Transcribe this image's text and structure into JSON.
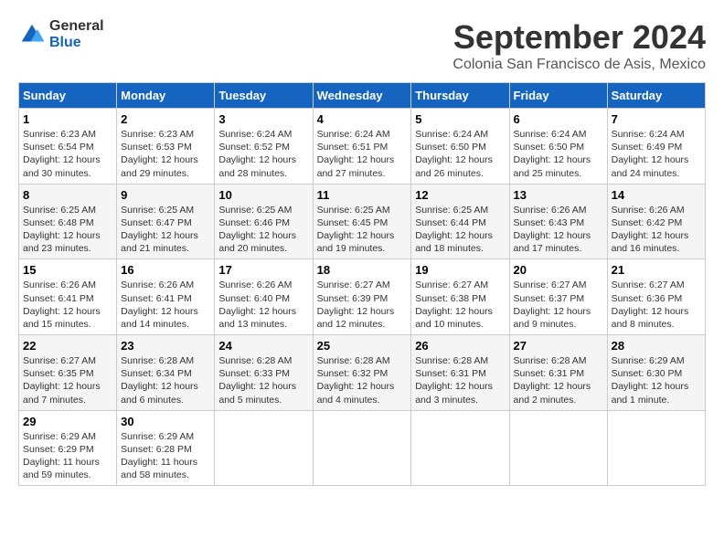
{
  "logo": {
    "general": "General",
    "blue": "Blue"
  },
  "title": "September 2024",
  "subtitle": "Colonia San Francisco de Asis, Mexico",
  "days_of_week": [
    "Sunday",
    "Monday",
    "Tuesday",
    "Wednesday",
    "Thursday",
    "Friday",
    "Saturday"
  ],
  "weeks": [
    [
      {
        "day": "1",
        "sunrise": "Sunrise: 6:23 AM",
        "sunset": "Sunset: 6:54 PM",
        "daylight": "Daylight: 12 hours and 30 minutes."
      },
      {
        "day": "2",
        "sunrise": "Sunrise: 6:23 AM",
        "sunset": "Sunset: 6:53 PM",
        "daylight": "Daylight: 12 hours and 29 minutes."
      },
      {
        "day": "3",
        "sunrise": "Sunrise: 6:24 AM",
        "sunset": "Sunset: 6:52 PM",
        "daylight": "Daylight: 12 hours and 28 minutes."
      },
      {
        "day": "4",
        "sunrise": "Sunrise: 6:24 AM",
        "sunset": "Sunset: 6:51 PM",
        "daylight": "Daylight: 12 hours and 27 minutes."
      },
      {
        "day": "5",
        "sunrise": "Sunrise: 6:24 AM",
        "sunset": "Sunset: 6:50 PM",
        "daylight": "Daylight: 12 hours and 26 minutes."
      },
      {
        "day": "6",
        "sunrise": "Sunrise: 6:24 AM",
        "sunset": "Sunset: 6:50 PM",
        "daylight": "Daylight: 12 hours and 25 minutes."
      },
      {
        "day": "7",
        "sunrise": "Sunrise: 6:24 AM",
        "sunset": "Sunset: 6:49 PM",
        "daylight": "Daylight: 12 hours and 24 minutes."
      }
    ],
    [
      {
        "day": "8",
        "sunrise": "Sunrise: 6:25 AM",
        "sunset": "Sunset: 6:48 PM",
        "daylight": "Daylight: 12 hours and 23 minutes."
      },
      {
        "day": "9",
        "sunrise": "Sunrise: 6:25 AM",
        "sunset": "Sunset: 6:47 PM",
        "daylight": "Daylight: 12 hours and 21 minutes."
      },
      {
        "day": "10",
        "sunrise": "Sunrise: 6:25 AM",
        "sunset": "Sunset: 6:46 PM",
        "daylight": "Daylight: 12 hours and 20 minutes."
      },
      {
        "day": "11",
        "sunrise": "Sunrise: 6:25 AM",
        "sunset": "Sunset: 6:45 PM",
        "daylight": "Daylight: 12 hours and 19 minutes."
      },
      {
        "day": "12",
        "sunrise": "Sunrise: 6:25 AM",
        "sunset": "Sunset: 6:44 PM",
        "daylight": "Daylight: 12 hours and 18 minutes."
      },
      {
        "day": "13",
        "sunrise": "Sunrise: 6:26 AM",
        "sunset": "Sunset: 6:43 PM",
        "daylight": "Daylight: 12 hours and 17 minutes."
      },
      {
        "day": "14",
        "sunrise": "Sunrise: 6:26 AM",
        "sunset": "Sunset: 6:42 PM",
        "daylight": "Daylight: 12 hours and 16 minutes."
      }
    ],
    [
      {
        "day": "15",
        "sunrise": "Sunrise: 6:26 AM",
        "sunset": "Sunset: 6:41 PM",
        "daylight": "Daylight: 12 hours and 15 minutes."
      },
      {
        "day": "16",
        "sunrise": "Sunrise: 6:26 AM",
        "sunset": "Sunset: 6:41 PM",
        "daylight": "Daylight: 12 hours and 14 minutes."
      },
      {
        "day": "17",
        "sunrise": "Sunrise: 6:26 AM",
        "sunset": "Sunset: 6:40 PM",
        "daylight": "Daylight: 12 hours and 13 minutes."
      },
      {
        "day": "18",
        "sunrise": "Sunrise: 6:27 AM",
        "sunset": "Sunset: 6:39 PM",
        "daylight": "Daylight: 12 hours and 12 minutes."
      },
      {
        "day": "19",
        "sunrise": "Sunrise: 6:27 AM",
        "sunset": "Sunset: 6:38 PM",
        "daylight": "Daylight: 12 hours and 10 minutes."
      },
      {
        "day": "20",
        "sunrise": "Sunrise: 6:27 AM",
        "sunset": "Sunset: 6:37 PM",
        "daylight": "Daylight: 12 hours and 9 minutes."
      },
      {
        "day": "21",
        "sunrise": "Sunrise: 6:27 AM",
        "sunset": "Sunset: 6:36 PM",
        "daylight": "Daylight: 12 hours and 8 minutes."
      }
    ],
    [
      {
        "day": "22",
        "sunrise": "Sunrise: 6:27 AM",
        "sunset": "Sunset: 6:35 PM",
        "daylight": "Daylight: 12 hours and 7 minutes."
      },
      {
        "day": "23",
        "sunrise": "Sunrise: 6:28 AM",
        "sunset": "Sunset: 6:34 PM",
        "daylight": "Daylight: 12 hours and 6 minutes."
      },
      {
        "day": "24",
        "sunrise": "Sunrise: 6:28 AM",
        "sunset": "Sunset: 6:33 PM",
        "daylight": "Daylight: 12 hours and 5 minutes."
      },
      {
        "day": "25",
        "sunrise": "Sunrise: 6:28 AM",
        "sunset": "Sunset: 6:32 PM",
        "daylight": "Daylight: 12 hours and 4 minutes."
      },
      {
        "day": "26",
        "sunrise": "Sunrise: 6:28 AM",
        "sunset": "Sunset: 6:31 PM",
        "daylight": "Daylight: 12 hours and 3 minutes."
      },
      {
        "day": "27",
        "sunrise": "Sunrise: 6:28 AM",
        "sunset": "Sunset: 6:31 PM",
        "daylight": "Daylight: 12 hours and 2 minutes."
      },
      {
        "day": "28",
        "sunrise": "Sunrise: 6:29 AM",
        "sunset": "Sunset: 6:30 PM",
        "daylight": "Daylight: 12 hours and 1 minute."
      }
    ],
    [
      {
        "day": "29",
        "sunrise": "Sunrise: 6:29 AM",
        "sunset": "Sunset: 6:29 PM",
        "daylight": "Daylight: 11 hours and 59 minutes."
      },
      {
        "day": "30",
        "sunrise": "Sunrise: 6:29 AM",
        "sunset": "Sunset: 6:28 PM",
        "daylight": "Daylight: 11 hours and 58 minutes."
      },
      null,
      null,
      null,
      null,
      null
    ]
  ]
}
